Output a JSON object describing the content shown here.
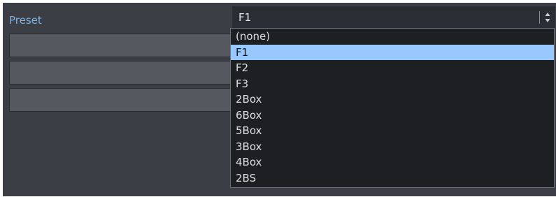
{
  "preset": {
    "label": "Preset",
    "selected_value": "F1"
  },
  "dropdown": {
    "options": [
      "(none)",
      "F1",
      "F2",
      "F3",
      "2Box",
      "6Box",
      "5Box",
      "3Box",
      "4Box",
      "2BS"
    ],
    "highlighted": "F1"
  },
  "colors": {
    "panel_bg": "#3b3e44",
    "label": "#79b3e6",
    "dropdown_bg": "#1d1f23",
    "highlight": "#99c8ff"
  },
  "icons": {
    "select_arrows": "up-down-arrows-icon"
  }
}
